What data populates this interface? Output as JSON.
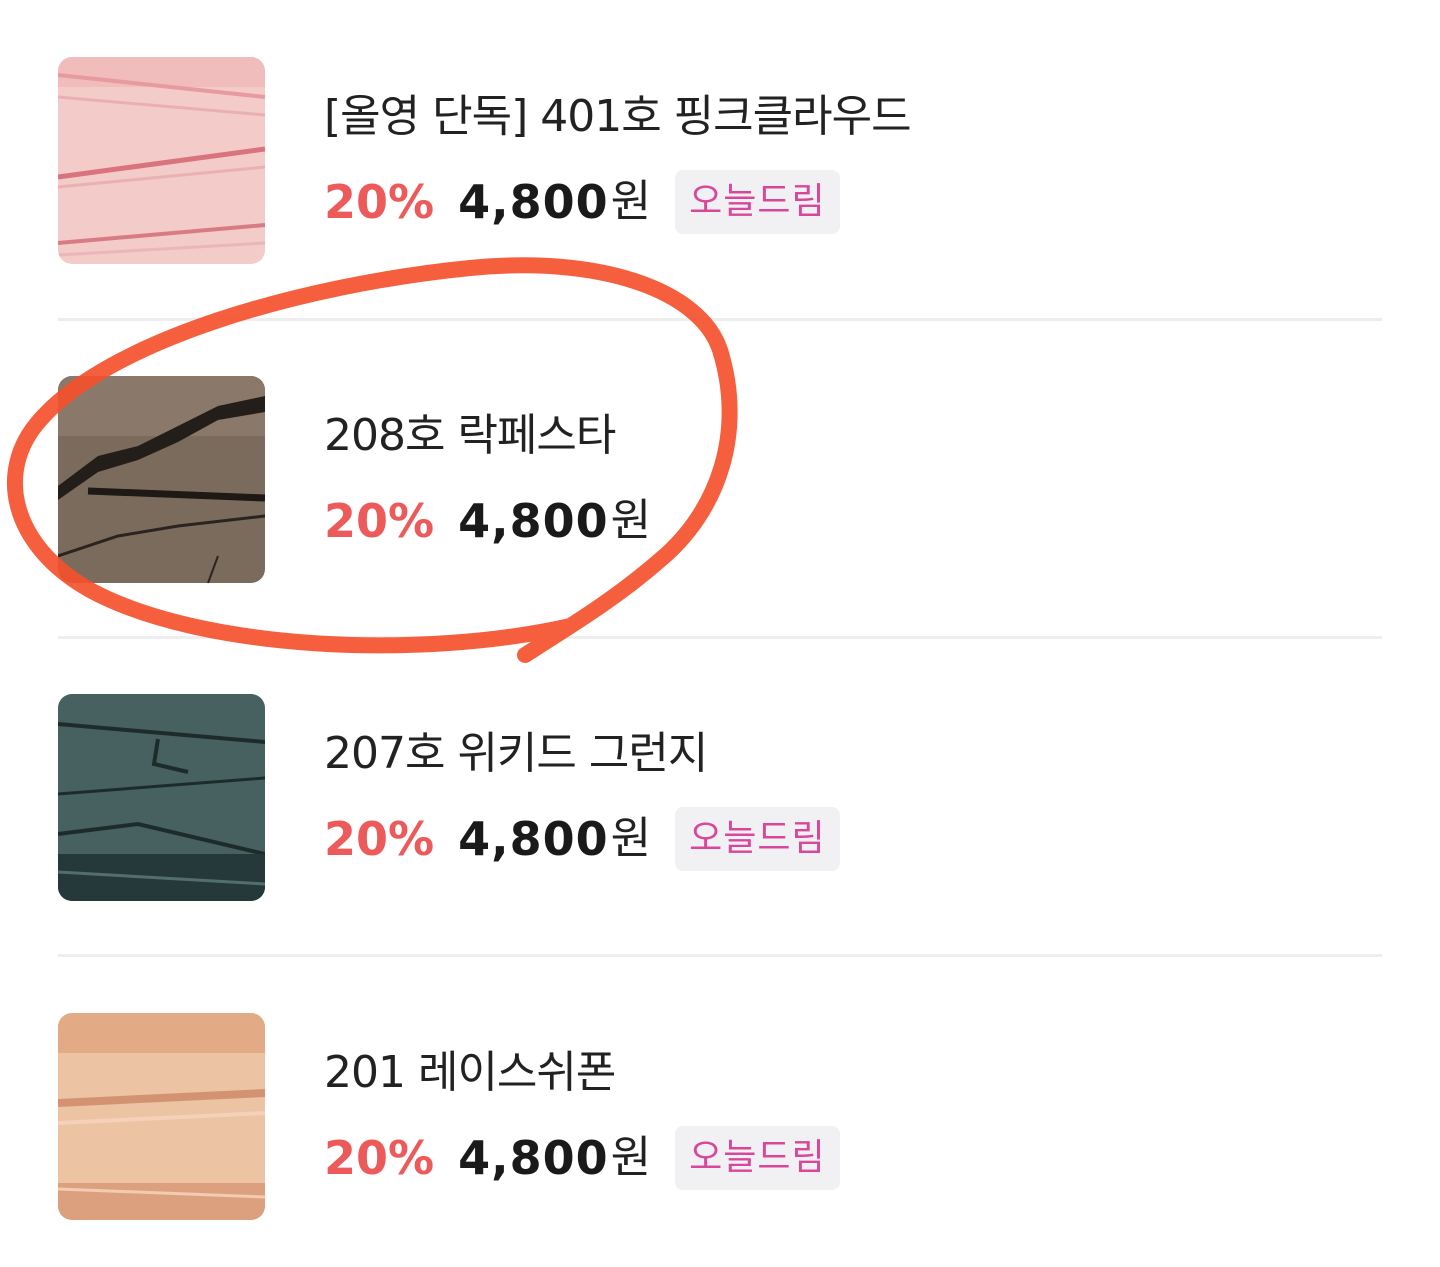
{
  "product_list": {
    "items": [
      {
        "name": "[올영 단독] 401호 핑크클라우드",
        "discount": "20%",
        "price": "4,800",
        "currency": "원",
        "badge": "오늘드림",
        "swatch_color": "#f2c9c7"
      },
      {
        "name": "208호 락페스타",
        "discount": "20%",
        "price": "4,800",
        "currency": "원",
        "badge": "",
        "swatch_color": "#7a6a5c"
      },
      {
        "name": "207호 위키드 그런지",
        "discount": "20%",
        "price": "4,800",
        "currency": "원",
        "badge": "오늘드림",
        "swatch_color": "#44615f"
      },
      {
        "name": "201 레이스쉬폰",
        "discount": "20%",
        "price": "4,800",
        "currency": "원",
        "badge": "오늘드림",
        "swatch_color": "#ebc09f"
      }
    ]
  },
  "colors": {
    "discount": "#ec5a5a",
    "badge_text": "#d9479a",
    "annotation_circle": "#f4512c"
  }
}
